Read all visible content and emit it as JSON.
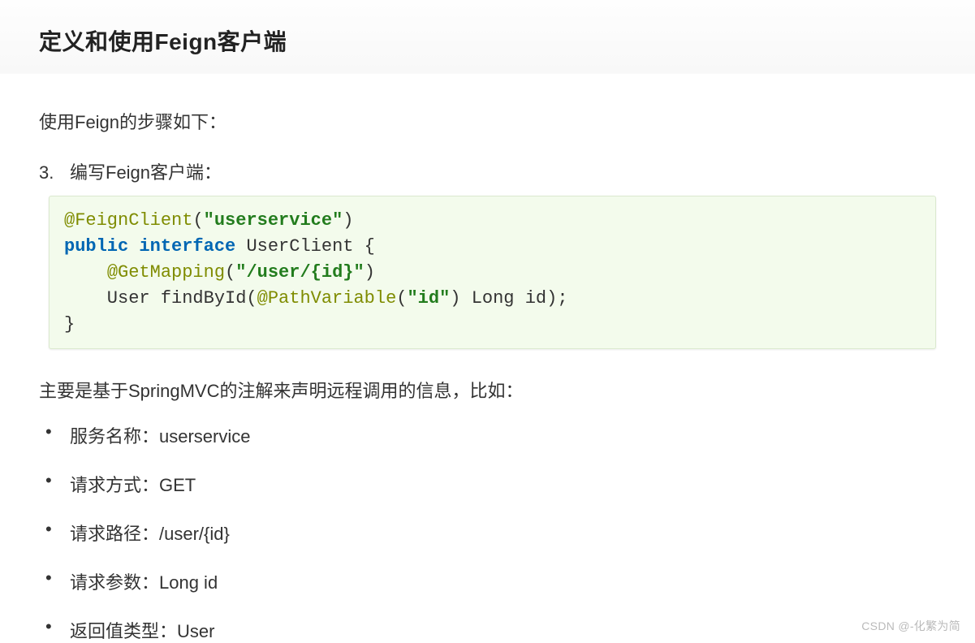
{
  "title": "定义和使用Feign客户端",
  "intro": "使用Feign的步骤如下：",
  "step_number": "3.",
  "step_text": "编写Feign客户端：",
  "code": {
    "t1": "@FeignClient",
    "t2": "(",
    "t3": "\"userservice\"",
    "t4": ")",
    "t5": "public",
    "t6": " ",
    "t7": "interface",
    "t8": " UserClient {",
    "t9": "    ",
    "t10": "@GetMapping",
    "t11": "(",
    "t12": "\"/user/{id}\"",
    "t13": ")",
    "t14": "    User findById(",
    "t15": "@PathVariable",
    "t16": "(",
    "t17": "\"id\"",
    "t18": ") Long id);",
    "t19": "}"
  },
  "desc": "主要是基于SpringMVC的注解来声明远程调用的信息，比如：",
  "bullets": [
    "服务名称：userservice",
    "请求方式：GET",
    "请求路径：/user/{id}",
    "请求参数：Long id",
    "返回值类型：User"
  ],
  "watermark": "CSDN @-化繁为简"
}
